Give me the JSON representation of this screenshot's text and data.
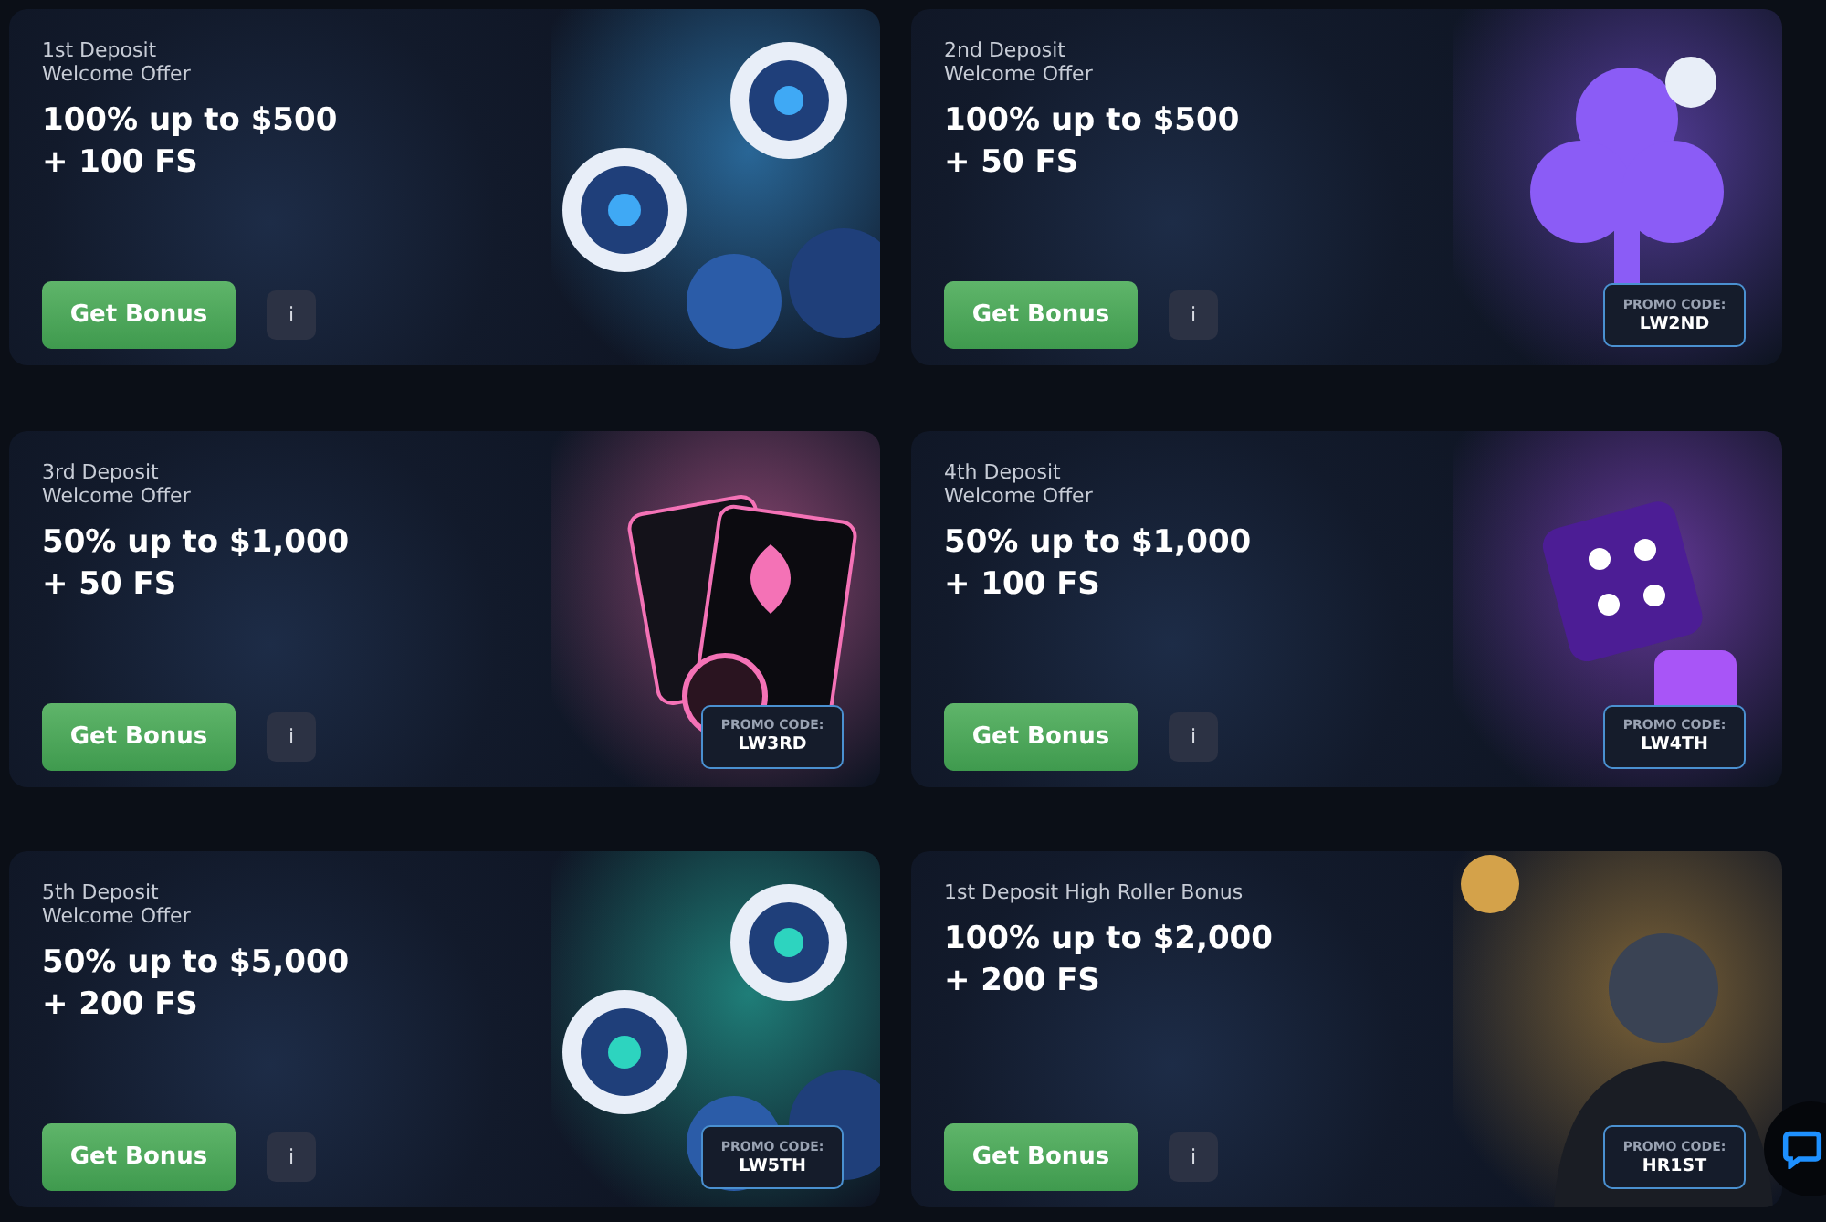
{
  "offers": [
    {
      "subtitle": [
        "1st Deposit",
        "Welcome Offer"
      ],
      "headline": [
        "100% up to $500",
        "+ 100 FS"
      ],
      "button": "Get Bonus",
      "info": "i",
      "art": {
        "kind": "chips",
        "color": "#3fa9f5"
      }
    },
    {
      "subtitle": [
        "2nd Deposit",
        "Welcome Offer"
      ],
      "headline": [
        "100% up to $500",
        "+ 50 FS"
      ],
      "button": "Get Bonus",
      "info": "i",
      "promo": {
        "label": "PROMO CODE:",
        "code": "LW2ND"
      },
      "art": {
        "kind": "clubs",
        "color": "#8b5cf6"
      }
    },
    {
      "subtitle": [
        "3rd Deposit",
        "Welcome Offer"
      ],
      "headline": [
        "50% up to $1,000",
        "+ 50 FS"
      ],
      "button": "Get Bonus",
      "info": "i",
      "promo": {
        "label": "PROMO CODE:",
        "code": "LW3RD"
      },
      "art": {
        "kind": "cards",
        "color": "#f472b6"
      }
    },
    {
      "subtitle": [
        "4th Deposit",
        "Welcome Offer"
      ],
      "headline": [
        "50% up to $1,000",
        "+ 100 FS"
      ],
      "button": "Get Bonus",
      "info": "i",
      "promo": {
        "label": "PROMO CODE:",
        "code": "LW4TH"
      },
      "art": {
        "kind": "dice",
        "color": "#a855f7"
      }
    },
    {
      "subtitle": [
        "5th Deposit",
        "Welcome Offer"
      ],
      "headline": [
        "50% up to $5,000",
        "+ 200 FS"
      ],
      "button": "Get Bonus",
      "info": "i",
      "promo": {
        "label": "PROMO CODE:",
        "code": "LW5TH"
      },
      "art": {
        "kind": "chips",
        "color": "#2dd4bf"
      }
    },
    {
      "subtitle": [
        "1st Deposit High Roller Bonus"
      ],
      "headline": [
        "100% up to $2,000",
        "+ 200 FS"
      ],
      "button": "Get Bonus",
      "info": "i",
      "promo": {
        "label": "PROMO CODE:",
        "code": "HR1ST"
      },
      "art": {
        "kind": "portrait",
        "color": "#d4a24a"
      }
    }
  ]
}
